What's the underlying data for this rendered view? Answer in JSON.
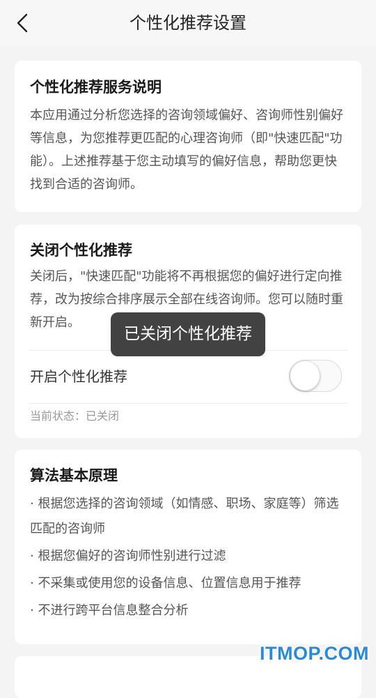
{
  "header": {
    "back_icon": "chevron-left-icon",
    "title": "个性化推荐设置"
  },
  "service_card": {
    "title": "个性化推荐服务说明",
    "text": "本应用通过分析您选择的咨询领域偏好、咨询师性别偏好等信息，为您推荐更匹配的心理咨询师（即\"快速匹配\"功能）。上述推荐基于您主动填写的偏好信息，帮助您更快找到合适的咨询师。"
  },
  "close_card": {
    "title": "关闭个性化推荐",
    "text": "关闭后，\"快速匹配\"功能将不再根据您的偏好进行定向推荐，改为按综合排序展示全部在线咨询师。您可以随时重新开启。",
    "toggle_label": "开启个性化推荐",
    "toggle_on": false,
    "status": "当前状态：已关闭"
  },
  "algorithm_card": {
    "title": "算法基本原理",
    "items": [
      "· 根据您选择的咨询领域（如情感、职场、家庭等）筛选匹配的咨询师",
      "· 根据您偏好的咨询师性别进行过滤",
      "· 不采集或使用您的设备信息、位置信息用于推荐",
      "· 不进行跨平台信息整合分析"
    ]
  },
  "toast": {
    "text": "已关闭个性化推荐"
  },
  "watermark": {
    "text": "ITMOP.COM",
    "color": "#2a8ad8"
  }
}
